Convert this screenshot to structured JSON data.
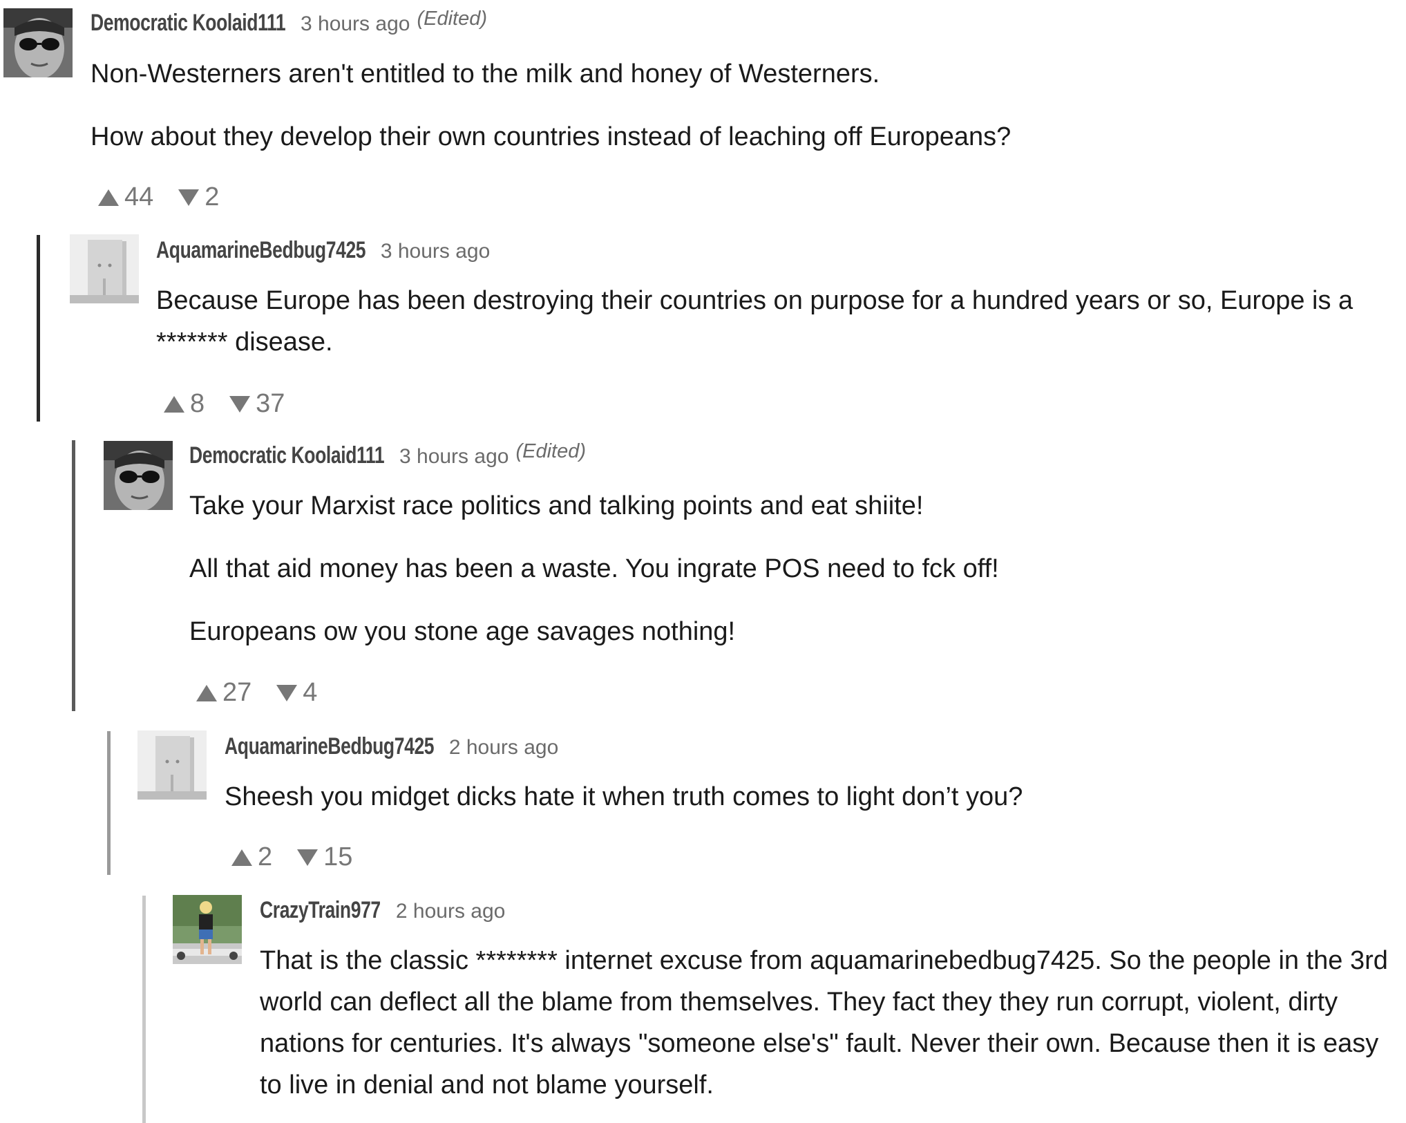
{
  "comments": [
    {
      "username": "Democratic Koolaid111",
      "time": "3 hours ago",
      "edited": "(Edited)",
      "avatar_icon": "dark-glasses-portrait-avatar",
      "paragraphs": [
        "Non-Westerners aren't entitled to the milk and honey of Westerners.",
        "How about they develop their own countries instead of leaching off Europeans?"
      ],
      "upvotes": "44",
      "downvotes": "2"
    },
    {
      "username": "AquamarineBedbug7425",
      "time": "3 hours ago",
      "avatar_icon": "box-face-avatar",
      "paragraphs": [
        "Because Europe has been destroying their countries on purpose for a hundred years or so, Europe is a ******* disease."
      ],
      "upvotes": "8",
      "downvotes": "37"
    },
    {
      "username": "Democratic Koolaid111",
      "time": "3 hours ago",
      "edited": "(Edited)",
      "avatar_icon": "dark-glasses-portrait-avatar",
      "paragraphs": [
        "Take your Marxist race politics and talking points and eat shiite!",
        "All that aid money has been a waste. You ingrate POS need to fck off!",
        "Europeans ow you stone age savages nothing!"
      ],
      "upvotes": "27",
      "downvotes": "4"
    },
    {
      "username": "AquamarineBedbug7425",
      "time": "2 hours ago",
      "avatar_icon": "box-face-avatar",
      "paragraphs": [
        "Sheesh you midget dicks hate it when truth comes to light don’t you?"
      ],
      "upvotes": "2",
      "downvotes": "15"
    },
    {
      "username": "CrazyTrain977",
      "time": "2 hours ago",
      "avatar_icon": "outdoor-person-photo-avatar",
      "paragraphs": [
        "That is the classic ******** internet excuse from aquamarinebedbug7425.  So the people in the 3rd world can deflect all the blame from themselves.  They fact they they run corrupt, violent, dirty nations for centuries.  It's always \"someone else's\" fault.  Never their own.  Because then it is easy to live in denial and not blame yourself."
      ]
    }
  ],
  "colors": {
    "thread_line_depth1": "#2a2a2a",
    "thread_line_depth2": "#5a5a5a",
    "thread_line_depth3": "#9a9a9a",
    "thread_line_depth4": "#c8c8c8",
    "vote_color": "#777777"
  }
}
